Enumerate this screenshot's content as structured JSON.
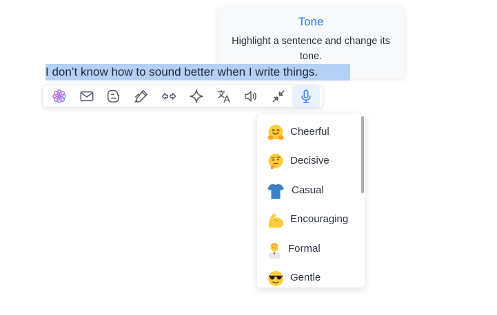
{
  "editor": {
    "selected_text": "I don’t know how to sound better when I write things."
  },
  "toolbar": {
    "items": [
      {
        "icon": "flower-logo-icon",
        "active": false
      },
      {
        "icon": "mail-icon",
        "active": false
      },
      {
        "icon": "blog-icon",
        "active": false
      },
      {
        "icon": "pen-icon",
        "active": false
      },
      {
        "icon": "arrows-left-right-icon",
        "active": false
      },
      {
        "icon": "sparkle-icon",
        "active": false
      },
      {
        "icon": "translate-icon",
        "active": false
      },
      {
        "icon": "speaker-icon",
        "active": false
      },
      {
        "icon": "shrink-arrows-icon",
        "active": false
      },
      {
        "icon": "microphone-icon",
        "active": true
      }
    ],
    "active_color": "#2f7fe0"
  },
  "tooltip": {
    "title": "Tone",
    "body": "Highlight a sentence and change its tone."
  },
  "tone_menu": {
    "items": [
      {
        "label": "Cheerful",
        "icon": "hugging-face-icon"
      },
      {
        "label": "Decisive",
        "icon": "thinking-face-icon"
      },
      {
        "label": "Casual",
        "icon": "tshirt-icon"
      },
      {
        "label": "Encouraging",
        "icon": "flexed-biceps-icon"
      },
      {
        "label": "Formal",
        "icon": "office-worker-icon"
      },
      {
        "label": "Gentle",
        "icon": "sunglasses-face-icon"
      }
    ]
  }
}
